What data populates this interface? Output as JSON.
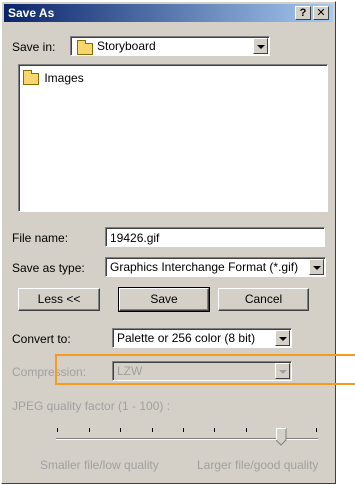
{
  "window": {
    "title": "Save As",
    "help_label": "?",
    "close_label": "✕"
  },
  "save_in": {
    "label": "Save in:",
    "value": "Storyboard",
    "icon": "folder-icon"
  },
  "file_list": {
    "items": [
      {
        "label": "Images",
        "icon": "folder-icon"
      }
    ]
  },
  "file_name": {
    "label": "File name:",
    "value": "19426.gif"
  },
  "save_as_type": {
    "label": "Save as type:",
    "value": "Graphics Interchange Format (*.gif)"
  },
  "buttons": {
    "less_label": "Less <<",
    "save_label": "Save",
    "cancel_label": "Cancel"
  },
  "convert_to": {
    "label": "Convert to:",
    "value": "Palette or 256 color (8 bit)"
  },
  "compression": {
    "label": "Compression:",
    "value": "LZW",
    "enabled": false
  },
  "jpeg_quality": {
    "label": "JPEG quality factor (1 - 100) :",
    "left_label": "Smaller file/low quality",
    "right_label": "Larger file/good quality",
    "enabled": false
  },
  "colors": {
    "titlebar_start": "#0a246a",
    "titlebar_end": "#a6caf0",
    "highlight": "#f39c1e"
  }
}
